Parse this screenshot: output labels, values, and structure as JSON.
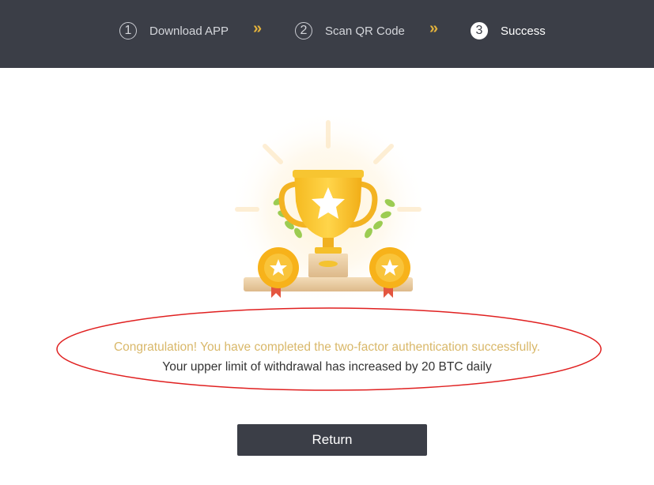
{
  "steps": [
    {
      "number": "1",
      "label": "Download APP"
    },
    {
      "number": "2",
      "label": "Scan QR Code"
    },
    {
      "number": "3",
      "label": "Success"
    }
  ],
  "step_separator_icon": "double-chevron-right-icon",
  "illustration": "trophy-with-medals-icon",
  "messages": {
    "success": "Congratulation! You have completed the two-factor authentication successfully.",
    "limit": "Your upper limit of withdrawal has increased by 20 BTC daily"
  },
  "return_button": {
    "label": "Return"
  },
  "colors": {
    "header_bg": "#3b3e47",
    "accent_gold": "#e3b23c",
    "success_text": "#d9b86a",
    "annotation_ellipse": "#e02020"
  }
}
